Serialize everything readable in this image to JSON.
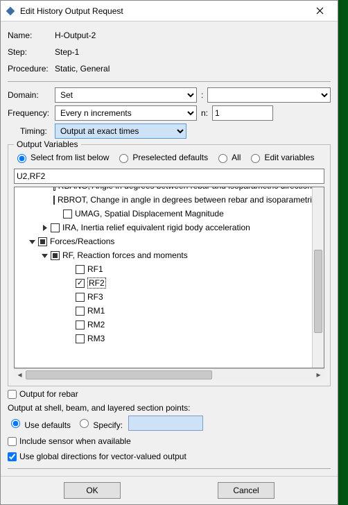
{
  "window": {
    "title": "Edit History Output Request"
  },
  "header": {
    "name_label": "Name:",
    "name_value": "H-Output-2",
    "step_label": "Step:",
    "step_value": "Step-1",
    "procedure_label": "Procedure:",
    "procedure_value": "Static, General"
  },
  "domain": {
    "label": "Domain:",
    "value": "Set",
    "colon": ":",
    "second_value": ""
  },
  "frequency": {
    "label": "Frequency:",
    "value": "Every n increments",
    "n_label": "n:",
    "n_value": "1"
  },
  "timing": {
    "label": "Timing:",
    "value": "Output at exact times"
  },
  "output_variables": {
    "group_title": "Output Variables",
    "mode_select": "Select from list below",
    "mode_preselected": "Preselected defaults",
    "mode_all": "All",
    "mode_edit": "Edit variables",
    "selected_text": "U2,RF2",
    "tree": {
      "items": [
        {
          "indent": 3,
          "twisty": "none",
          "cb": "unchecked",
          "label": "RBANG, Angle in degrees between rebar and isoparametric direction"
        },
        {
          "indent": 3,
          "twisty": "none",
          "cb": "unchecked",
          "label": "RBROT, Change in angle in degrees between rebar and isoparametric direction"
        },
        {
          "indent": 3,
          "twisty": "none",
          "cb": "unchecked",
          "label": "UMAG, Spatial Displacement Magnitude"
        },
        {
          "indent": 2,
          "twisty": "right",
          "cb": "unchecked",
          "label": "IRA, Inertia relief equivalent rigid body acceleration"
        },
        {
          "indent": 1,
          "twisty": "down",
          "cb": "mixed",
          "label": "Forces/Reactions"
        },
        {
          "indent": 2,
          "twisty": "down",
          "cb": "mixed",
          "label": "RF, Reaction forces and moments"
        },
        {
          "indent": 4,
          "twisty": "none",
          "cb": "unchecked",
          "label": "RF1"
        },
        {
          "indent": 4,
          "twisty": "none",
          "cb": "checked",
          "label": "RF2",
          "selected": true
        },
        {
          "indent": 4,
          "twisty": "none",
          "cb": "unchecked",
          "label": "RF3"
        },
        {
          "indent": 4,
          "twisty": "none",
          "cb": "unchecked",
          "label": "RM1"
        },
        {
          "indent": 4,
          "twisty": "none",
          "cb": "unchecked",
          "label": "RM2"
        },
        {
          "indent": 4,
          "twisty": "none",
          "cb": "unchecked",
          "label": "RM3"
        }
      ]
    }
  },
  "lower": {
    "output_for_rebar": "Output for rebar",
    "section_points_label": "Output at shell, beam, and layered section points:",
    "use_defaults": "Use defaults",
    "specify": "Specify:",
    "include_sensor": "Include sensor when available",
    "global_directions": "Use global directions for vector-valued output"
  },
  "buttons": {
    "ok": "OK",
    "cancel": "Cancel"
  }
}
